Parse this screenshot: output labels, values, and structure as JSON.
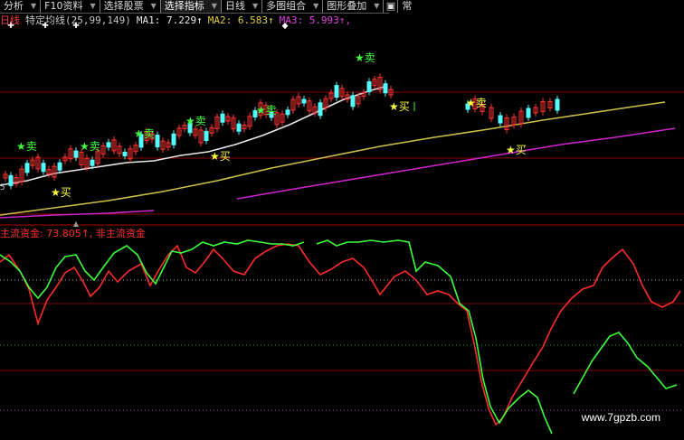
{
  "toolbar": {
    "buttons": [
      {
        "label": "分析",
        "caret": true
      },
      {
        "label": "F10资料",
        "caret": true
      },
      {
        "label": "选择股票",
        "caret": true
      },
      {
        "label": "选择指标",
        "caret": true,
        "active": true
      },
      {
        "label": "日线",
        "caret": true
      },
      {
        "label": "多图组合",
        "caret": true
      },
      {
        "label": "图形叠加",
        "caret": true
      }
    ],
    "extra_char": "常"
  },
  "header": {
    "period": "日线",
    "indicator": "特定均线",
    "params": "(25,99,149)",
    "ma1": "MA1: 7.229↑",
    "ma2": "MA2: 6.583↑",
    "ma3": "MA3: 5.993↑,"
  },
  "indicator_header": {
    "main": "主流资金: 73.805↑,",
    "non_main": "非主流资金"
  },
  "signals": {
    "buy": "★买",
    "sell": "★卖"
  },
  "price_label_left": "5",
  "watermark": "www.7gpzb.com",
  "colors": {
    "up": "#ff3232",
    "down": "#54fcfc",
    "ma1": "#e8e8e8",
    "ma2": "#ccc04a",
    "ma3": "#cc24cc",
    "main_fund": "#ff2a2a",
    "non_main": "#3cff3c",
    "buy": "#ffff40",
    "sell": "#40ff40",
    "grid": "#8a0000"
  }
}
